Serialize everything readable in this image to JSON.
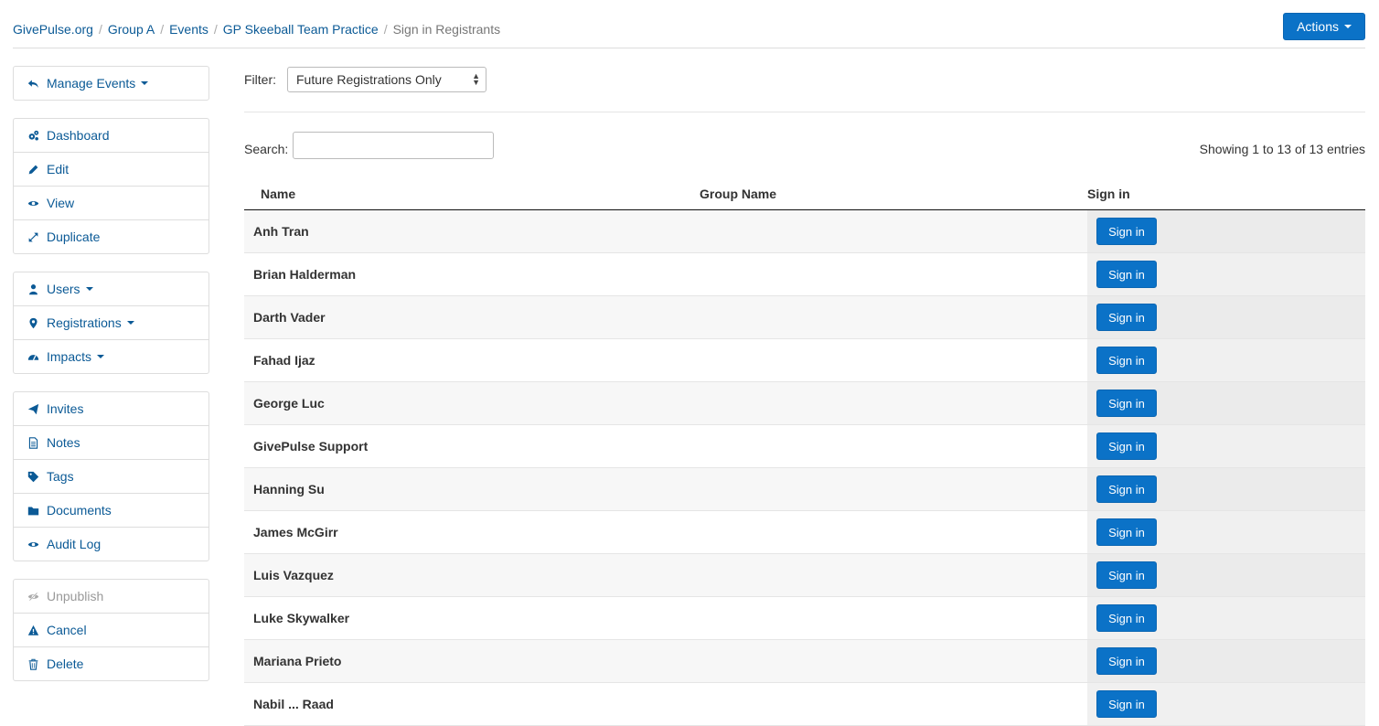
{
  "breadcrumb": [
    {
      "label": "GivePulse.org"
    },
    {
      "label": "Group A"
    },
    {
      "label": "Events"
    },
    {
      "label": "GP Skeeball Team Practice"
    },
    {
      "label": "Sign in Registrants"
    }
  ],
  "actions_label": "Actions",
  "sidebar": {
    "manage_events": "Manage Events",
    "items": [
      {
        "label": "Dashboard"
      },
      {
        "label": "Edit"
      },
      {
        "label": "View"
      },
      {
        "label": "Duplicate"
      },
      {
        "label": "Users"
      },
      {
        "label": "Registrations"
      },
      {
        "label": "Impacts"
      },
      {
        "label": "Invites"
      },
      {
        "label": "Notes"
      },
      {
        "label": "Tags"
      },
      {
        "label": "Documents"
      },
      {
        "label": "Audit Log"
      },
      {
        "label": "Unpublish"
      },
      {
        "label": "Cancel"
      },
      {
        "label": "Delete"
      }
    ]
  },
  "filter": {
    "label": "Filter:",
    "selected": "Future Registrations Only"
  },
  "search": {
    "label": "Search:",
    "value": ""
  },
  "showing_text": "Showing 1 to 13 of 13 entries",
  "table": {
    "headers": [
      "Name",
      "Group Name",
      "Sign in"
    ],
    "rows": [
      {
        "name": "Anh Tran",
        "group": "",
        "button": "Sign in"
      },
      {
        "name": "Brian Halderman",
        "group": "",
        "button": "Sign in"
      },
      {
        "name": "Darth Vader",
        "group": "",
        "button": "Sign in"
      },
      {
        "name": "Fahad Ijaz",
        "group": "",
        "button": "Sign in"
      },
      {
        "name": "George Luc",
        "group": "",
        "button": "Sign in"
      },
      {
        "name": "GivePulse Support",
        "group": "",
        "button": "Sign in"
      },
      {
        "name": "Hanning Su",
        "group": "",
        "button": "Sign in"
      },
      {
        "name": "James McGirr",
        "group": "",
        "button": "Sign in"
      },
      {
        "name": "Luis Vazquez",
        "group": "",
        "button": "Sign in"
      },
      {
        "name": "Luke Skywalker",
        "group": "",
        "button": "Sign in"
      },
      {
        "name": "Mariana Prieto",
        "group": "",
        "button": "Sign in"
      },
      {
        "name": "Nabil ... Raad",
        "group": "",
        "button": "Sign in"
      }
    ]
  },
  "colors": {
    "primary": "#0b72c7",
    "link": "#0b5a96"
  }
}
